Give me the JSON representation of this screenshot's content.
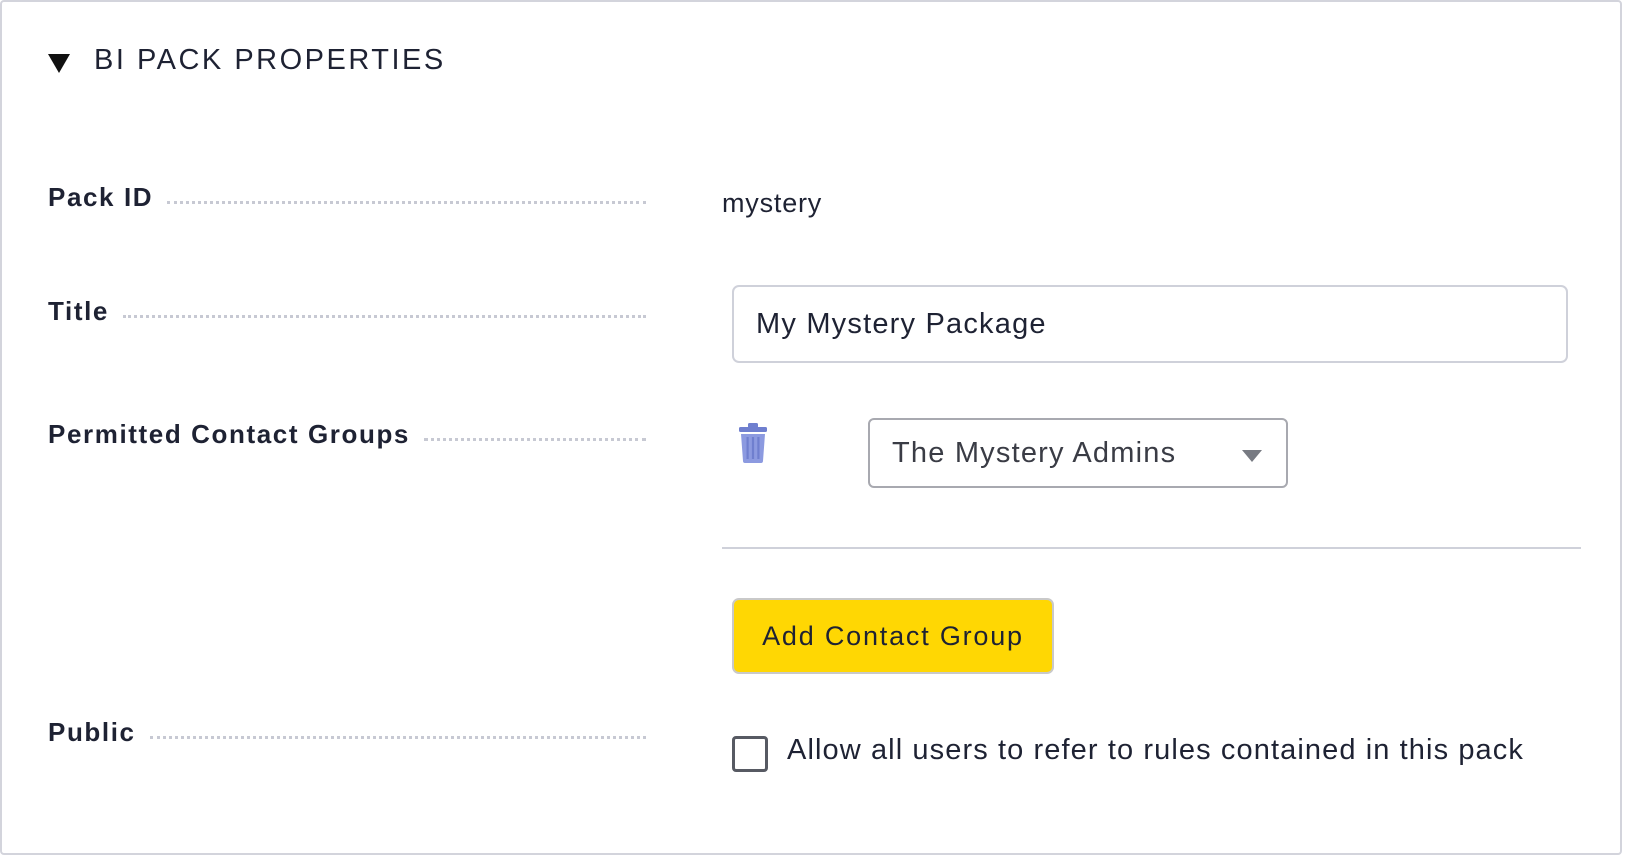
{
  "section": {
    "title": "BI PACK PROPERTIES",
    "toggle_icon": "triangle-down-icon"
  },
  "fields": {
    "pack_id": {
      "label": "Pack ID",
      "value": "mystery"
    },
    "title": {
      "label": "Title",
      "value": "My Mystery Package"
    },
    "contact_groups": {
      "label": "Permitted Contact Groups",
      "delete_icon": "trash-icon",
      "icon_color": "#6f7fcf",
      "selected": "The Mystery Admins",
      "add_button_label": "Add Contact Group",
      "add_button_color": "#ffd703"
    },
    "public": {
      "label": "Public",
      "checked": false,
      "checkbox_label": "Allow all users to refer to rules contained in this pack"
    }
  }
}
